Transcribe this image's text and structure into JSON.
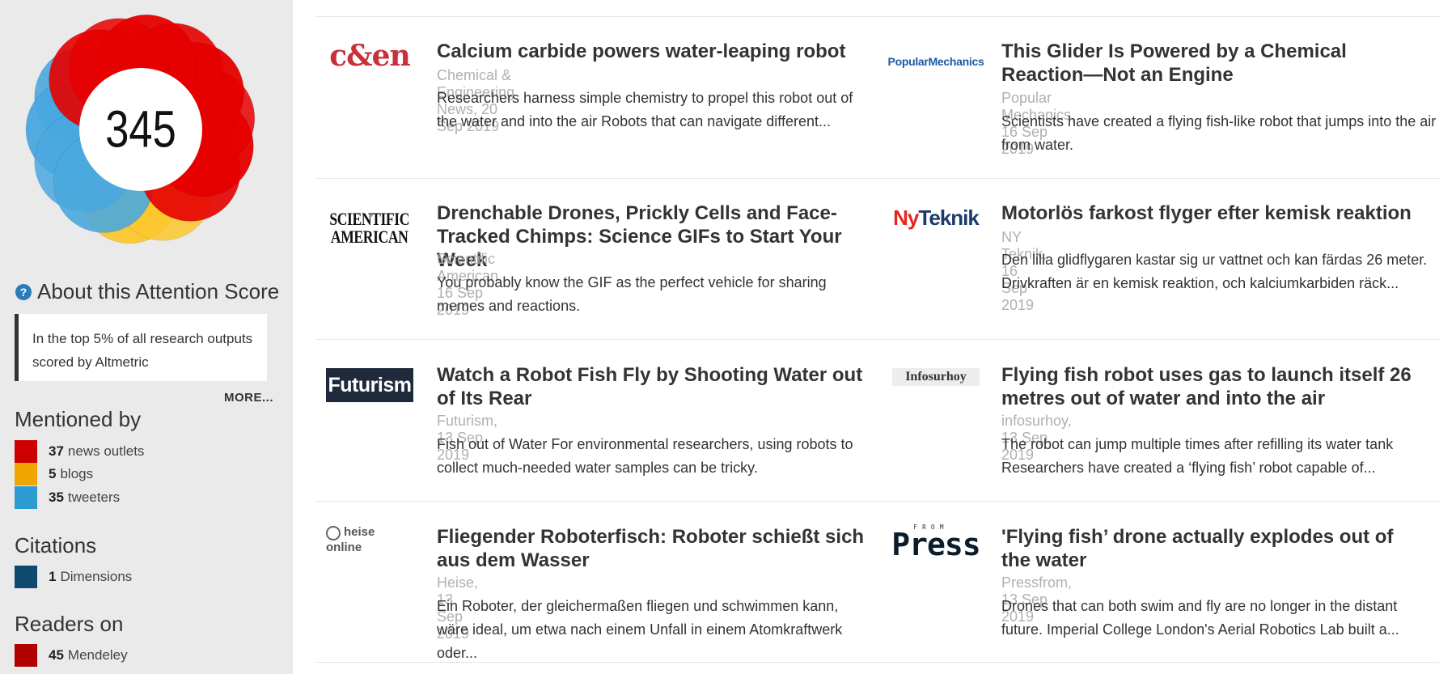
{
  "score": "345",
  "about": {
    "icon": "question-circle-icon",
    "label": "About this Attention Score",
    "box_text": "In the top 5% of all research outputs scored by Altmetric",
    "more_label": "MORE..."
  },
  "mentioned_by": {
    "heading": "Mentioned by",
    "items": [
      {
        "count": "37",
        "label": "news outlets",
        "color": "#cc0000"
      },
      {
        "count": "5",
        "label": "blogs",
        "color": "#f0a500"
      },
      {
        "count": "35",
        "label": "tweeters",
        "color": "#2d9bd1"
      }
    ]
  },
  "citations": {
    "heading": "Citations",
    "items": [
      {
        "count": "1",
        "label": "Dimensions",
        "color": "#0f4a6e"
      }
    ]
  },
  "readers": {
    "heading": "Readers on",
    "items": [
      {
        "count": "45",
        "label": "Mendeley",
        "color": "#b00000"
      }
    ]
  },
  "donut_colors": {
    "news": "#e60000",
    "blogs": "#fcc72e",
    "tweeters": "#4aa8df"
  },
  "news": [
    {
      "logo": "c&en",
      "title": "Calcium carbide powers water-leaping robot",
      "meta": "Chemical & Engineering News, 20 Sep 2019",
      "snippet": "Researchers harness simple chemistry to propel this robot out of the water and into the air Robots that can navigate different..."
    },
    {
      "logo": "PopularMechanics",
      "title": "This Glider Is Powered by a Chemical Reaction—Not an Engine",
      "meta": "Popular Mechanics, 16 Sep 2019",
      "snippet": "Scientists have created a flying fish-like robot that jumps into the air from water."
    },
    {
      "logo": "SCIENTIFIC AMERICAN",
      "title": "Drenchable Drones, Prickly Cells and Face-Tracked Chimps: Science GIFs to Start Your Week",
      "meta": "Scientific American, 16 Sep 2019",
      "snippet": "You probably know the GIF as the perfect vehicle for sharing memes and reactions."
    },
    {
      "logo_ny": "Ny",
      "logo_teknik": "Teknik",
      "title": "Motorlös farkost flyger efter kemisk reaktion",
      "meta": "NY Teknik, 16 Sep 2019",
      "snippet": "Den lilla glidflygaren kastar sig ur vattnet och kan färdas 26 meter. Drivkraften är en kemisk reaktion, och kalciumkarbiden räck..."
    },
    {
      "logo": "Futurism",
      "title": "Watch a Robot Fish Fly by Shooting Water out of Its Rear",
      "meta": "Futurism, 13 Sep 2019",
      "snippet": "Fish out of Water For environmental researchers, using robots to collect much-needed water samples can be tricky."
    },
    {
      "logo": "Infosurhoy",
      "title": "Flying fish robot uses gas to launch itself 26 metres out of water and into the air",
      "meta": "infosurhoy, 13 Sep 2019",
      "snippet": "The robot can jump multiple times after refilling its water tank Researchers have created a ‘flying fish’ robot capable of..."
    },
    {
      "logo": "heise online",
      "title": "Fliegender Roboterfisch: Roboter schießt sich aus dem Wasser",
      "meta": "Heise, 13 Sep 2019",
      "snippet": "Ein Roboter, der gleichermaßen fliegen und schwimmen kann, wäre ideal, um etwa nach einem Unfall in einem Atomkraftwerk oder..."
    },
    {
      "logo": "Press",
      "logo_small": "FROM",
      "title": "'Flying fish’ drone actually explodes out of the water",
      "meta": "Pressfrom, 13 Sep 2019",
      "snippet": "Drones that can both swim and fly are no longer in the distant future. Imperial College London's Aerial Robotics Lab built a..."
    }
  ]
}
